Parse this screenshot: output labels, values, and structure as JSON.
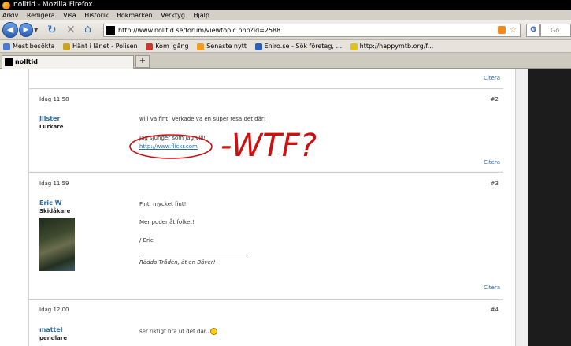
{
  "window": {
    "title": "nolltid - Mozilla Firefox"
  },
  "menu": [
    "Arkiv",
    "Redigera",
    "Visa",
    "Historik",
    "Bokmärken",
    "Verktyg",
    "Hjälp"
  ],
  "nav": {
    "url": "http://www.nolltid.se/forum/viewtopic.php?id=2588",
    "search_label": "Go"
  },
  "bookmarks": [
    {
      "label": "Mest besökta",
      "color": "#4a7bd0"
    },
    {
      "label": "Hänt i länet - Polisen",
      "color": "#c9a227"
    },
    {
      "label": "Kom igång",
      "color": "#d0342c"
    },
    {
      "label": "Senaste nytt",
      "color": "#f29b1d"
    },
    {
      "label": "Eniro.se - Sök företag, ...",
      "color": "#2d5fb3"
    },
    {
      "label": "http://happymtb.org/f...",
      "color": "#e0c21a"
    }
  ],
  "tab": {
    "label": "nolltid",
    "new_tab": "+"
  },
  "forum": {
    "top_citera": "Citera",
    "posts": [
      {
        "date": "Idag 11.58",
        "num": "#2",
        "user": "Jilster",
        "rank": "Lurkare",
        "line1": "wiii va fint! Verkade va en super resa det där!",
        "line2": "Jag sjunger som jag vill!",
        "link": "http://www.flickr.com",
        "citera": "Citera"
      },
      {
        "date": "Idag 11.59",
        "num": "#3",
        "user": "Eric W",
        "rank": "Skidåkare",
        "line1": "Fint, mycket fint!",
        "line2": "Mer puder åt folket!",
        "line3": "/ Eric",
        "sig": "Rädda Tråden, ät en Bäver!",
        "citera": "Citera"
      },
      {
        "date": "Idag 12.00",
        "num": "#4",
        "user": "mattel",
        "rank": "pendlare",
        "line1": "ser riktigt bra ut det där.."
      }
    ]
  },
  "annotation": {
    "text": "-WTF?",
    "color": "#cc1111"
  }
}
